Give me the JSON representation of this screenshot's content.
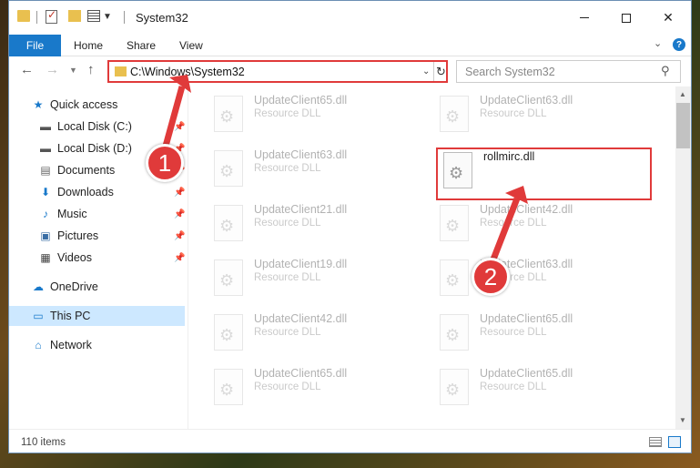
{
  "window": {
    "title": "System32"
  },
  "ribbon": {
    "tabs": [
      "File",
      "Home",
      "Share",
      "View"
    ]
  },
  "address": {
    "path": "C:\\Windows\\System32"
  },
  "search": {
    "placeholder": "Search System32"
  },
  "sidebar": {
    "items": [
      {
        "label": "Quick access",
        "icon": "star-icon"
      },
      {
        "label": "Local Disk (C:)",
        "icon": "drive-icon"
      },
      {
        "label": "Local Disk (D:)",
        "icon": "drive-icon"
      },
      {
        "label": "Documents",
        "icon": "documents-icon"
      },
      {
        "label": "Downloads",
        "icon": "download-icon"
      },
      {
        "label": "Music",
        "icon": "music-icon"
      },
      {
        "label": "Pictures",
        "icon": "pictures-icon"
      },
      {
        "label": "Videos",
        "icon": "videos-icon"
      },
      {
        "label": "OneDrive",
        "icon": "cloud-icon"
      },
      {
        "label": "This PC",
        "icon": "computer-icon"
      },
      {
        "label": "Network",
        "icon": "network-icon"
      }
    ]
  },
  "files": [
    {
      "name": "UpdateClient65.dll",
      "type": "Resource DLL"
    },
    {
      "name": "UpdateClient63.dll",
      "type": "Resource DLL"
    },
    {
      "name": "UpdateClient63.dll",
      "type": "Resource DLL"
    },
    {
      "name": "rollmirc.dll",
      "type": ""
    },
    {
      "name": "UpdateClient21.dll",
      "type": "Resource DLL"
    },
    {
      "name": "UpdateClient42.dll",
      "type": "Resource DLL"
    },
    {
      "name": "UpdateClient19.dll",
      "type": "Resource DLL"
    },
    {
      "name": "UpdateClient63.dll",
      "type": "Resource DLL"
    },
    {
      "name": "UpdateClient42.dll",
      "type": "Resource DLL"
    },
    {
      "name": "UpdateClient65.dll",
      "type": "Resource DLL"
    },
    {
      "name": "UpdateClient65.dll",
      "type": "Resource DLL"
    },
    {
      "name": "UpdateClient65.dll",
      "type": "Resource DLL"
    }
  ],
  "status": {
    "item_count": "110 items"
  },
  "callouts": [
    "1",
    "2"
  ],
  "colors": {
    "accent": "#1979ca",
    "callout": "#e03a3a"
  }
}
